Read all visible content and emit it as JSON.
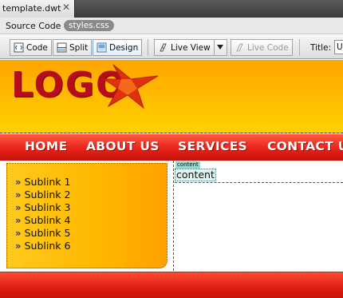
{
  "document_tab": {
    "title": "template.dwt",
    "close_glyph": "✕"
  },
  "related_files": {
    "source_label": "Source Code",
    "css_file": "styles.css"
  },
  "toolbar": {
    "code_label": "Code",
    "split_label": "Split",
    "design_label": "Design",
    "live_view_label": "Live View",
    "live_code_label": "Live Code",
    "title_label": "Title:",
    "title_value": "Ur"
  },
  "page": {
    "logo_text": "LOGO",
    "nav": [
      "HOME",
      "ABOUT US",
      "SERVICES",
      "CONTACT US"
    ],
    "sublinks": [
      "» Sublink 1",
      "» Sublink 2",
      "» Sublink 3",
      "» Sublink 4",
      "» Sublink 5",
      "» Sublink 6"
    ],
    "content_tag": "content",
    "content_text": "content"
  },
  "colors": {
    "header_orange": "#ffb400",
    "nav_red": "#e8231b",
    "logo_red": "#b50d1a",
    "sidebar_orange": "#ffb800",
    "content_tag_teal": "#9ad7d0"
  },
  "icons": [
    "close-icon",
    "code-view-icon",
    "split-view-icon",
    "design-view-icon",
    "live-view-icon",
    "dropdown-arrow-icon",
    "live-code-icon",
    "logo-star-icon"
  ]
}
